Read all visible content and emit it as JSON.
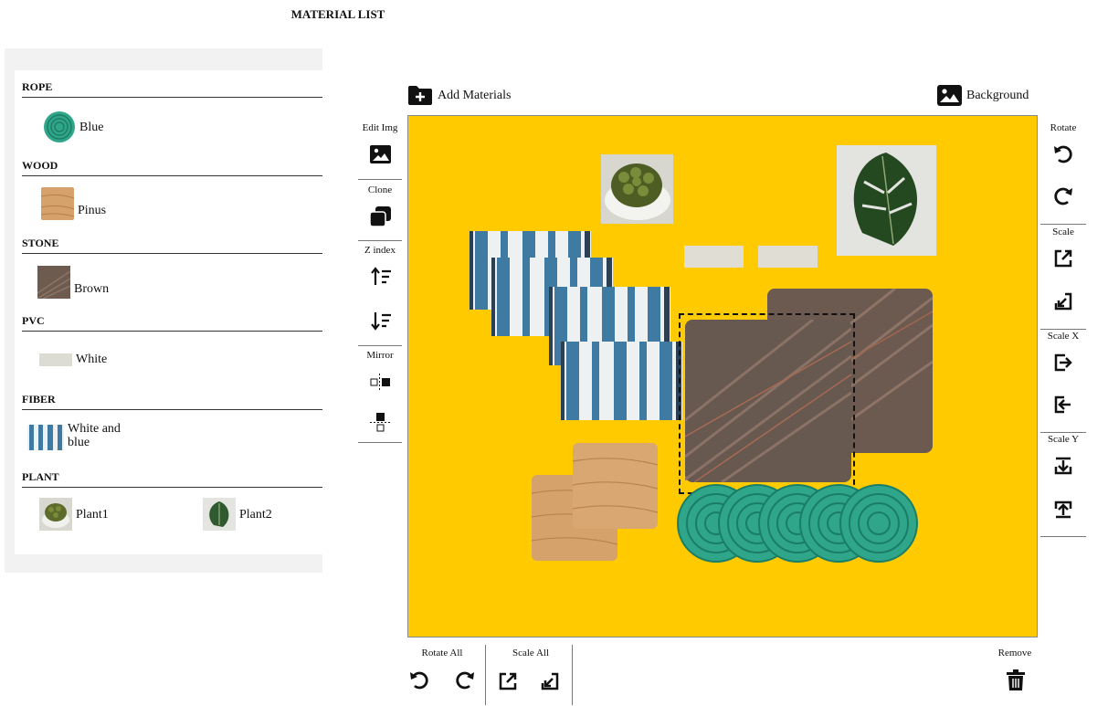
{
  "page": {
    "title": "MATERIAL LIST"
  },
  "materials": [
    {
      "category": "ROPE",
      "items": [
        {
          "name": "Blue",
          "thumb": "rope-blue"
        }
      ]
    },
    {
      "category": "WOOD",
      "items": [
        {
          "name": "Pinus",
          "thumb": "wood"
        }
      ]
    },
    {
      "category": "STONE",
      "items": [
        {
          "name": "Brown",
          "thumb": "stone"
        }
      ]
    },
    {
      "category": "PVC",
      "items": [
        {
          "name": "White",
          "thumb": "pvc"
        }
      ]
    },
    {
      "category": "FIBER",
      "items": [
        {
          "name": "White and blue",
          "thumb": "fiber"
        }
      ]
    },
    {
      "category": "PLANT",
      "items": [
        {
          "name": "Plant1",
          "thumb": "plant1"
        },
        {
          "name": "Plant2",
          "thumb": "plant2"
        }
      ]
    }
  ],
  "toolbar": {
    "add_materials": "Add Materials",
    "background": "Background",
    "add_icon": "folder-plus-icon",
    "background_icon": "image-icon"
  },
  "left_tools": {
    "edit_img": "Edit Img",
    "clone": "Clone",
    "z_index": "Z index",
    "mirror": "Mirror"
  },
  "right_tools": {
    "rotate": "Rotate",
    "scale": "Scale",
    "scale_x": "Scale X",
    "scale_y": "Scale Y"
  },
  "bottom_tools": {
    "rotate_all": "Rotate All",
    "scale_all": "Scale All",
    "remove": "Remove"
  },
  "colors": {
    "canvas_background": "#ffcb00",
    "rope": "#2fa68a",
    "fiber_blue": "#3f7aa3",
    "wood": "#d6a26c",
    "stone": "#6e5b50"
  }
}
